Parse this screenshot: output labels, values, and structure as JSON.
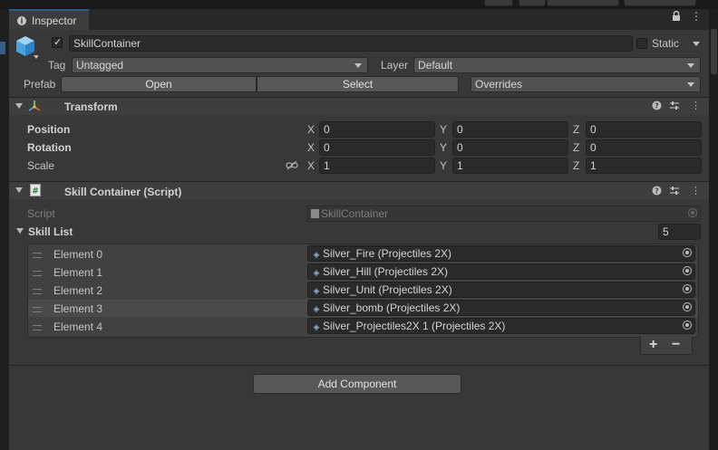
{
  "window": {
    "tab_label": "Inspector",
    "lock_icon": "lock-icon",
    "menu_icon": "kebab-menu-icon"
  },
  "header": {
    "active": true,
    "name": "SkillContainer",
    "static_label": "Static",
    "tag_label": "Tag",
    "tag_value": "Untagged",
    "layer_label": "Layer",
    "layer_value": "Default",
    "prefab_label": "Prefab",
    "open_label": "Open",
    "select_label": "Select",
    "overrides_label": "Overrides"
  },
  "transform": {
    "title": "Transform",
    "rows": [
      {
        "label": "Position",
        "x": "0",
        "y": "0",
        "z": "0"
      },
      {
        "label": "Rotation",
        "x": "0",
        "y": "0",
        "z": "0"
      },
      {
        "label": "Scale",
        "x": "1",
        "y": "1",
        "z": "1"
      }
    ],
    "axis_x": "X",
    "axis_y": "Y",
    "axis_z": "Z"
  },
  "script_component": {
    "title": "Skill Container (Script)",
    "script_label": "Script",
    "script_value": "SkillContainer",
    "list_label": "Skill List",
    "list_count": "5",
    "elements": [
      {
        "label": "Element 0",
        "value": "Silver_Fire (Projectiles 2X)"
      },
      {
        "label": "Element 1",
        "value": "Silver_Hill (Projectiles 2X)"
      },
      {
        "label": "Element 2",
        "value": "Silver_Unit (Projectiles 2X)"
      },
      {
        "label": "Element 3",
        "value": "Silver_bomb (Projectiles 2X)"
      },
      {
        "label": "Element 4",
        "value": "Silver_Projectiles2X 1 (Projectiles 2X)"
      }
    ],
    "add_label": "+",
    "remove_label": "−"
  },
  "add_component_label": "Add Component",
  "colors": {
    "panel": "#383838",
    "header_bg": "#3e3e3e",
    "field_bg": "#2a2a2a",
    "accent_tab": "#2c5d87"
  }
}
